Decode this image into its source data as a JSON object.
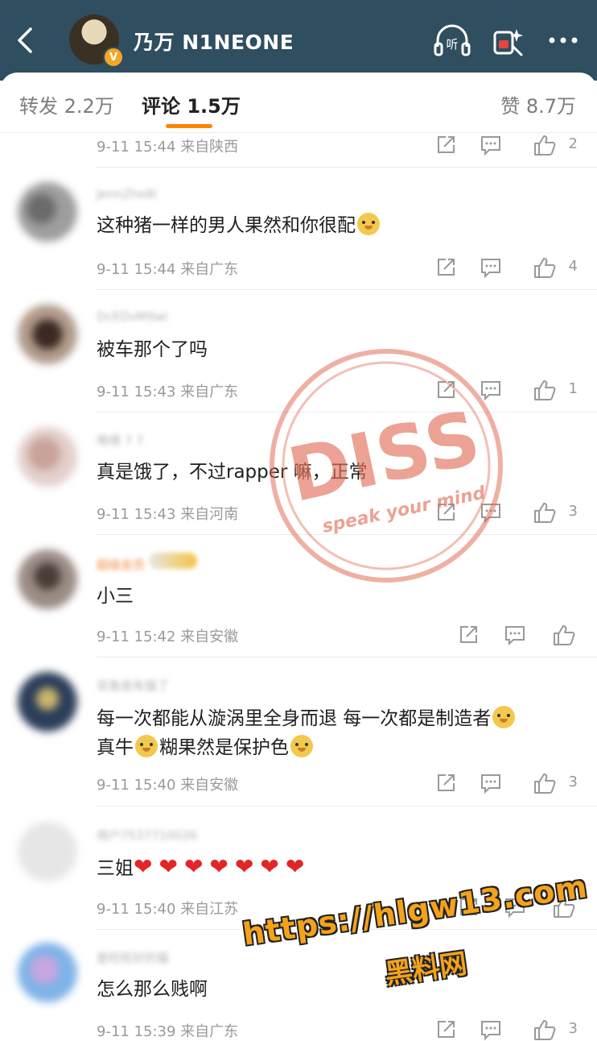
{
  "header": {
    "title": "乃万 N1NEONE",
    "listen_label": "听",
    "verified_badge": "V"
  },
  "tabs": [
    {
      "label": "转发 2.2万"
    },
    {
      "label": "评论 1.5万"
    },
    {
      "label": "赞 8.7万"
    }
  ],
  "comments": [
    {
      "text": "",
      "time": "9-11 15:44",
      "location": "来自陕西",
      "likes": "2"
    },
    {
      "name": "JennZhe8i",
      "text": "这种猪一样的男人果然和你很配",
      "time": "9-11 15:44",
      "location": "来自广东",
      "likes": "4"
    },
    {
      "name": "DcEDvM9wi",
      "text": "被车那个了吗",
      "time": "9-11 15:43",
      "location": "来自广东",
      "likes": "1"
    },
    {
      "name": "嗯嗯 7 7",
      "text": "真是饿了，不过rapper 嘛，正常",
      "time": "9-11 15:43",
      "location": "来自河南",
      "likes": "3"
    },
    {
      "name": "超级会员",
      "text": "小三",
      "time": "9-11 15:42",
      "location": "来自安徽",
      "likes": ""
    },
    {
      "name": "双鱼座有猫了",
      "text_line1": "每一次都能从漩涡里全身而退 每一次都是制造者",
      "text_line2_a": "真牛",
      "text_line2_b": "糊果然是保护色",
      "time": "9-11 15:40",
      "location": "来自安徽",
      "likes": "3"
    },
    {
      "name": "用户7537710026",
      "text": "三姐",
      "time": "9-11 15:40",
      "location": "来自江苏",
      "likes": ""
    },
    {
      "name": "是旺旺好的猫",
      "text": "怎么那么贱啊",
      "time": "9-11 15:39",
      "location": "来自广东",
      "likes": "3"
    }
  ],
  "watermark": {
    "stamp_title": "DISS",
    "stamp_sub": "speak your mind",
    "url": "https://hlgw13.com",
    "site": "黑料网"
  },
  "colors": {
    "header_bg": "#2f4e5f",
    "accent": "#ff8200",
    "heart": "#e22626",
    "stamp": "#e2705a"
  }
}
